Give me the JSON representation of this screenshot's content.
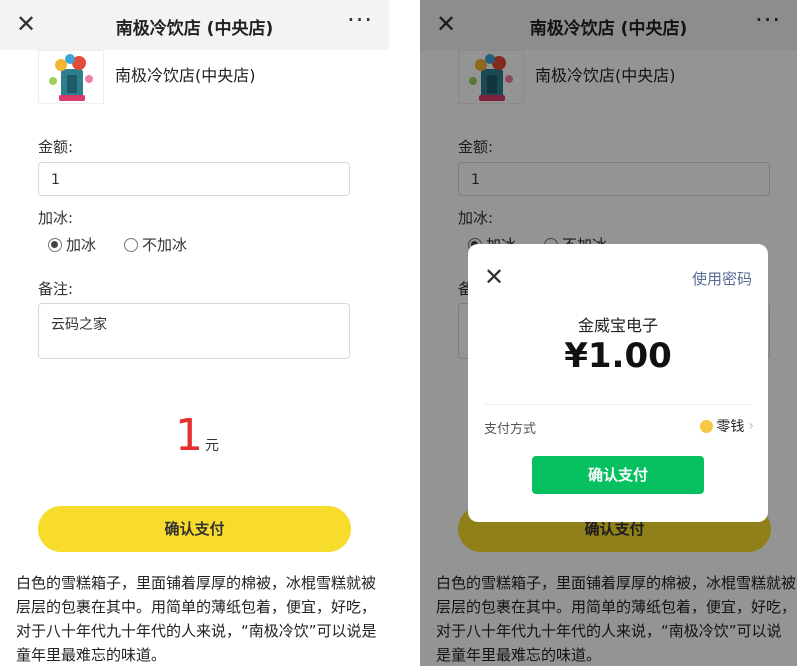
{
  "header": {
    "close_glyph": "✕",
    "title": "南极冷饮店 (中央店)",
    "more_glyph": "···"
  },
  "shop": {
    "name": "南极冷饮店(中央店)",
    "logo_icon": "ice-cream-logo"
  },
  "form": {
    "amount_label": "金额:",
    "amount_value": "1",
    "ice_label": "加冰:",
    "ice_options": [
      {
        "label": "加冰",
        "checked": true
      },
      {
        "label": "不加冰",
        "checked": false
      }
    ],
    "note_label": "备注:",
    "note_value": "云码之家"
  },
  "total": {
    "value": "1",
    "unit": "元"
  },
  "pay_button": {
    "label": "确认支付",
    "color": "#f8dc2c"
  },
  "description": "白色的雪糕箱子，里面铺着厚厚的棉被，冰棍雪糕就被层层的包裹在其中。用简单的薄纸包着，便宜，好吃，对于八十年代九十年代的人来说，“南极冷饮”可以说是童年里最难忘的味道。",
  "payment_dialog": {
    "close_glyph": "✕",
    "use_password": "使用密码",
    "merchant": "金威宝电子",
    "amount": "¥1.00",
    "method_label": "支付方式",
    "method_value": "零钱",
    "confirm_label": "确认支付",
    "confirm_color": "#07c160",
    "link_color": "#576b95"
  }
}
